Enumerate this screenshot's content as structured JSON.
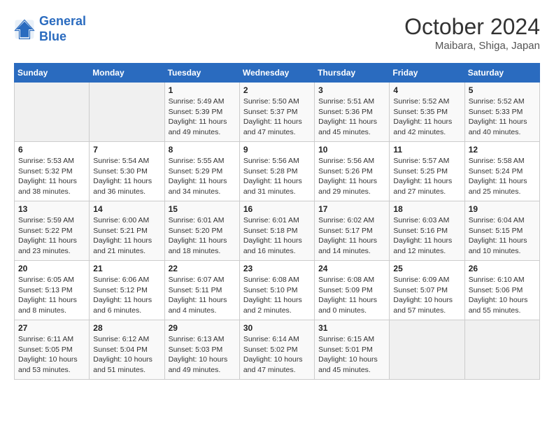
{
  "header": {
    "logo_line1": "General",
    "logo_line2": "Blue",
    "month": "October 2024",
    "location": "Maibara, Shiga, Japan"
  },
  "weekdays": [
    "Sunday",
    "Monday",
    "Tuesday",
    "Wednesday",
    "Thursday",
    "Friday",
    "Saturday"
  ],
  "weeks": [
    [
      {
        "day": "",
        "info": ""
      },
      {
        "day": "",
        "info": ""
      },
      {
        "day": "1",
        "sunrise": "5:49 AM",
        "sunset": "5:39 PM",
        "daylight": "11 hours and 49 minutes."
      },
      {
        "day": "2",
        "sunrise": "5:50 AM",
        "sunset": "5:37 PM",
        "daylight": "11 hours and 47 minutes."
      },
      {
        "day": "3",
        "sunrise": "5:51 AM",
        "sunset": "5:36 PM",
        "daylight": "11 hours and 45 minutes."
      },
      {
        "day": "4",
        "sunrise": "5:52 AM",
        "sunset": "5:35 PM",
        "daylight": "11 hours and 42 minutes."
      },
      {
        "day": "5",
        "sunrise": "5:52 AM",
        "sunset": "5:33 PM",
        "daylight": "11 hours and 40 minutes."
      }
    ],
    [
      {
        "day": "6",
        "sunrise": "5:53 AM",
        "sunset": "5:32 PM",
        "daylight": "11 hours and 38 minutes."
      },
      {
        "day": "7",
        "sunrise": "5:54 AM",
        "sunset": "5:30 PM",
        "daylight": "11 hours and 36 minutes."
      },
      {
        "day": "8",
        "sunrise": "5:55 AM",
        "sunset": "5:29 PM",
        "daylight": "11 hours and 34 minutes."
      },
      {
        "day": "9",
        "sunrise": "5:56 AM",
        "sunset": "5:28 PM",
        "daylight": "11 hours and 31 minutes."
      },
      {
        "day": "10",
        "sunrise": "5:56 AM",
        "sunset": "5:26 PM",
        "daylight": "11 hours and 29 minutes."
      },
      {
        "day": "11",
        "sunrise": "5:57 AM",
        "sunset": "5:25 PM",
        "daylight": "11 hours and 27 minutes."
      },
      {
        "day": "12",
        "sunrise": "5:58 AM",
        "sunset": "5:24 PM",
        "daylight": "11 hours and 25 minutes."
      }
    ],
    [
      {
        "day": "13",
        "sunrise": "5:59 AM",
        "sunset": "5:22 PM",
        "daylight": "11 hours and 23 minutes."
      },
      {
        "day": "14",
        "sunrise": "6:00 AM",
        "sunset": "5:21 PM",
        "daylight": "11 hours and 21 minutes."
      },
      {
        "day": "15",
        "sunrise": "6:01 AM",
        "sunset": "5:20 PM",
        "daylight": "11 hours and 18 minutes."
      },
      {
        "day": "16",
        "sunrise": "6:01 AM",
        "sunset": "5:18 PM",
        "daylight": "11 hours and 16 minutes."
      },
      {
        "day": "17",
        "sunrise": "6:02 AM",
        "sunset": "5:17 PM",
        "daylight": "11 hours and 14 minutes."
      },
      {
        "day": "18",
        "sunrise": "6:03 AM",
        "sunset": "5:16 PM",
        "daylight": "11 hours and 12 minutes."
      },
      {
        "day": "19",
        "sunrise": "6:04 AM",
        "sunset": "5:15 PM",
        "daylight": "11 hours and 10 minutes."
      }
    ],
    [
      {
        "day": "20",
        "sunrise": "6:05 AM",
        "sunset": "5:13 PM",
        "daylight": "11 hours and 8 minutes."
      },
      {
        "day": "21",
        "sunrise": "6:06 AM",
        "sunset": "5:12 PM",
        "daylight": "11 hours and 6 minutes."
      },
      {
        "day": "22",
        "sunrise": "6:07 AM",
        "sunset": "5:11 PM",
        "daylight": "11 hours and 4 minutes."
      },
      {
        "day": "23",
        "sunrise": "6:08 AM",
        "sunset": "5:10 PM",
        "daylight": "11 hours and 2 minutes."
      },
      {
        "day": "24",
        "sunrise": "6:08 AM",
        "sunset": "5:09 PM",
        "daylight": "11 hours and 0 minutes."
      },
      {
        "day": "25",
        "sunrise": "6:09 AM",
        "sunset": "5:07 PM",
        "daylight": "10 hours and 57 minutes."
      },
      {
        "day": "26",
        "sunrise": "6:10 AM",
        "sunset": "5:06 PM",
        "daylight": "10 hours and 55 minutes."
      }
    ],
    [
      {
        "day": "27",
        "sunrise": "6:11 AM",
        "sunset": "5:05 PM",
        "daylight": "10 hours and 53 minutes."
      },
      {
        "day": "28",
        "sunrise": "6:12 AM",
        "sunset": "5:04 PM",
        "daylight": "10 hours and 51 minutes."
      },
      {
        "day": "29",
        "sunrise": "6:13 AM",
        "sunset": "5:03 PM",
        "daylight": "10 hours and 49 minutes."
      },
      {
        "day": "30",
        "sunrise": "6:14 AM",
        "sunset": "5:02 PM",
        "daylight": "10 hours and 47 minutes."
      },
      {
        "day": "31",
        "sunrise": "6:15 AM",
        "sunset": "5:01 PM",
        "daylight": "10 hours and 45 minutes."
      },
      {
        "day": "",
        "info": ""
      },
      {
        "day": "",
        "info": ""
      }
    ]
  ]
}
